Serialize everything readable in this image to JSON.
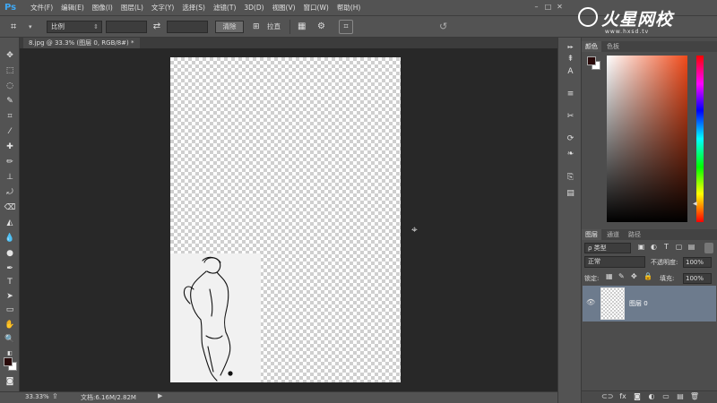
{
  "app": {
    "logo": "Ps"
  },
  "menu": [
    "文件(F)",
    "编辑(E)",
    "图像(I)",
    "图层(L)",
    "文字(Y)",
    "选择(S)",
    "滤镜(T)",
    "3D(D)",
    "视图(V)",
    "窗口(W)",
    "帮助(H)"
  ],
  "window_controls": {
    "minimize": "–",
    "maximize": "□",
    "close": "✕"
  },
  "watermark": {
    "title": "火星网校",
    "url": "www.hxsd.tv"
  },
  "options": {
    "ratio": "比例",
    "clear_label": "清除",
    "straighten_label": "拉直",
    "ratio_width": "",
    "ratio_height": ""
  },
  "document": {
    "tab_title": "8.jpg @ 33.3% (图层 0, RGB/8#) *"
  },
  "status": {
    "zoom": "33.33%",
    "doc_info": "文档:6.16M/2.82M"
  },
  "color_panel": {
    "tabs": [
      "颜色",
      "色板"
    ],
    "foreground": "#2a0a0a",
    "background": "#ffffff"
  },
  "layers_panel": {
    "tabs": [
      "图层",
      "通道",
      "路径"
    ],
    "filter_kind": "ρ 类型",
    "blend_mode": "正常",
    "opacity_label": "不透明度:",
    "opacity": "100%",
    "lock_label": "锁定:",
    "fill_label": "填充:",
    "fill": "100%",
    "layers": [
      {
        "name": "图层 0",
        "visible": true
      }
    ]
  },
  "tools": [
    "move-icon",
    "marquee-icon",
    "lasso-icon",
    "quick-select-icon",
    "crop-icon",
    "eyedropper-icon",
    "healing-icon",
    "brush-icon",
    "stamp-icon",
    "history-brush-icon",
    "eraser-icon",
    "gradient-icon",
    "blur-icon",
    "dodge-icon",
    "pen-icon",
    "type-icon",
    "path-select-icon",
    "rectangle-icon",
    "hand-icon",
    "zoom-icon"
  ]
}
